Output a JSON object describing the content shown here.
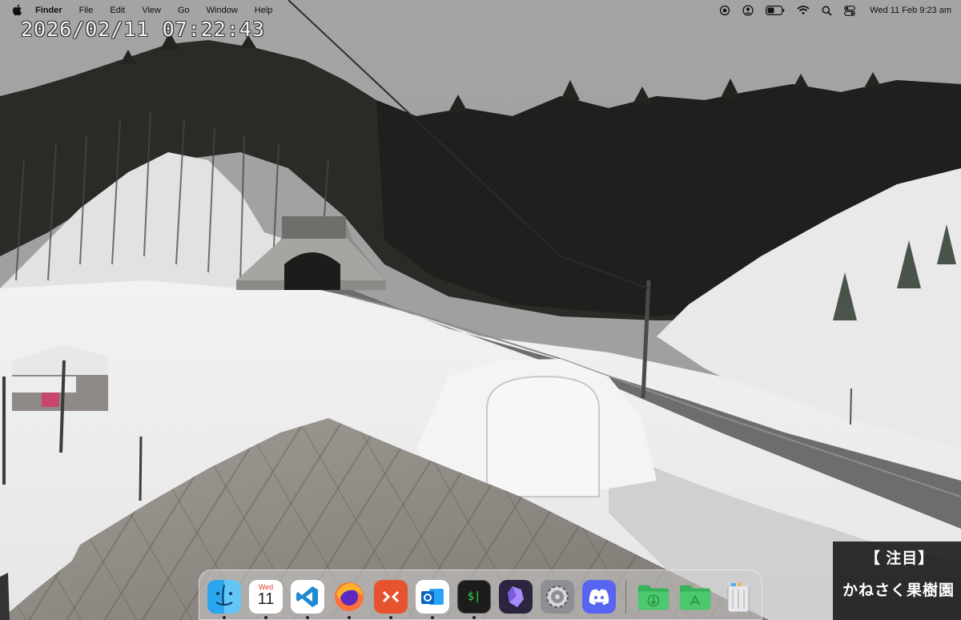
{
  "menubar": {
    "apple_icon": "apple-logo-icon",
    "app_name": "Finder",
    "menus": [
      "File",
      "Edit",
      "View",
      "Go",
      "Window",
      "Help"
    ],
    "status_icons": [
      "screen-record-icon",
      "user-account-icon",
      "battery-icon",
      "wifi-icon",
      "spotlight-search-icon",
      "control-center-icon"
    ],
    "clock": "Wed 11 Feb  9:23 am"
  },
  "webcam": {
    "timestamp": "2026/02/11 07:22:43",
    "caption_line1": "【 注目】",
    "caption_line2": "かねさく果樹園"
  },
  "dock": {
    "apps": [
      {
        "name": "Finder",
        "icon": "finder-icon",
        "running": true
      },
      {
        "name": "Calendar",
        "icon": "calendar-icon",
        "month": "Wed",
        "day": "11",
        "running": true
      },
      {
        "name": "Visual Studio Code",
        "icon": "vscode-icon",
        "running": true
      },
      {
        "name": "Firefox",
        "icon": "firefox-icon",
        "running": true
      },
      {
        "name": "Remote Desktop",
        "icon": "remote-desktop-icon",
        "running": true
      },
      {
        "name": "Outlook",
        "icon": "outlook-icon",
        "running": true
      },
      {
        "name": "Terminal",
        "icon": "terminal-icon",
        "glyph": "$|",
        "running": true
      },
      {
        "name": "Obsidian",
        "icon": "obsidian-icon",
        "running": false
      },
      {
        "name": "System Settings",
        "icon": "gear-icon",
        "running": false
      },
      {
        "name": "Discord",
        "icon": "discord-icon",
        "running": false
      }
    ],
    "folders": [
      {
        "name": "Downloads",
        "icon": "downloads-folder-icon"
      },
      {
        "name": "Applications",
        "icon": "applications-folder-icon"
      }
    ],
    "trash": {
      "name": "Trash",
      "icon": "trash-icon"
    }
  }
}
